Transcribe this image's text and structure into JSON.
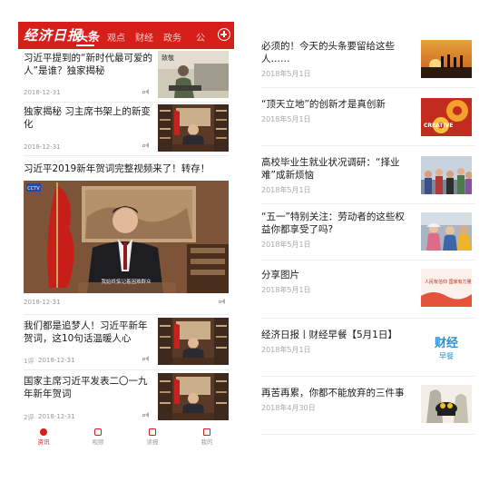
{
  "left": {
    "header": {
      "logo": "经济日报",
      "tabs": [
        "头条",
        "观点",
        "财经",
        "政务",
        "公"
      ]
    },
    "news": [
      {
        "title": "习近平提到的“新时代最可爱的人”是谁？独家揭秘",
        "date": "2018-12-31",
        "comments": ""
      },
      {
        "title": "独家揭秘 习主席书架上的新变化",
        "date": "2018-12-31",
        "comments": ""
      },
      {
        "title": "习近平2019新年贺词完整视频来了！转存！",
        "date": "2018-12-31",
        "comments": "",
        "video_caption": "我始终惦记着困难群众"
      },
      {
        "title": "我们都是追梦人！习近平新年贺词，这10句话温暖人心",
        "date": "2018-12-31",
        "comments": "1评"
      },
      {
        "title": "国家主席习近平发表二〇一九年新年贺词",
        "date": "2018-12-31",
        "comments": "2评"
      }
    ],
    "thumb_text": {
      "first": "致敬"
    },
    "bottom_nav": [
      "资讯",
      "视频",
      "读报",
      "我的"
    ],
    "colors": {
      "brand": "#d81e1a"
    }
  },
  "right": {
    "items": [
      {
        "title": "必须的！今天的头条要留给这些人……",
        "date": "2018年5月1日"
      },
      {
        "title": "“顶天立地”的创新才是真创新",
        "date": "2018年5月1日",
        "thumb_text": "CREATIVE"
      },
      {
        "title": "高校毕业生就业状况调研：“择业难”成新烦恼",
        "date": "2018年5月1日"
      },
      {
        "title": "“五一”特别关注：劳动者的这些权益你都享受了吗?",
        "date": "2018年5月1日"
      },
      {
        "title": "分享图片",
        "date": "2018年5月1日",
        "thumb_text": "人民有信仰 国家有力量"
      },
      {
        "title": "经济日报丨财经早餐【5月1日】",
        "date": "2018年5月1日",
        "thumb_text": {
          "main": "财经",
          "sub": "早餐"
        }
      },
      {
        "title": "再苦再累，你都不能放弃的三件事",
        "date": "2018年4月30日"
      }
    ]
  }
}
